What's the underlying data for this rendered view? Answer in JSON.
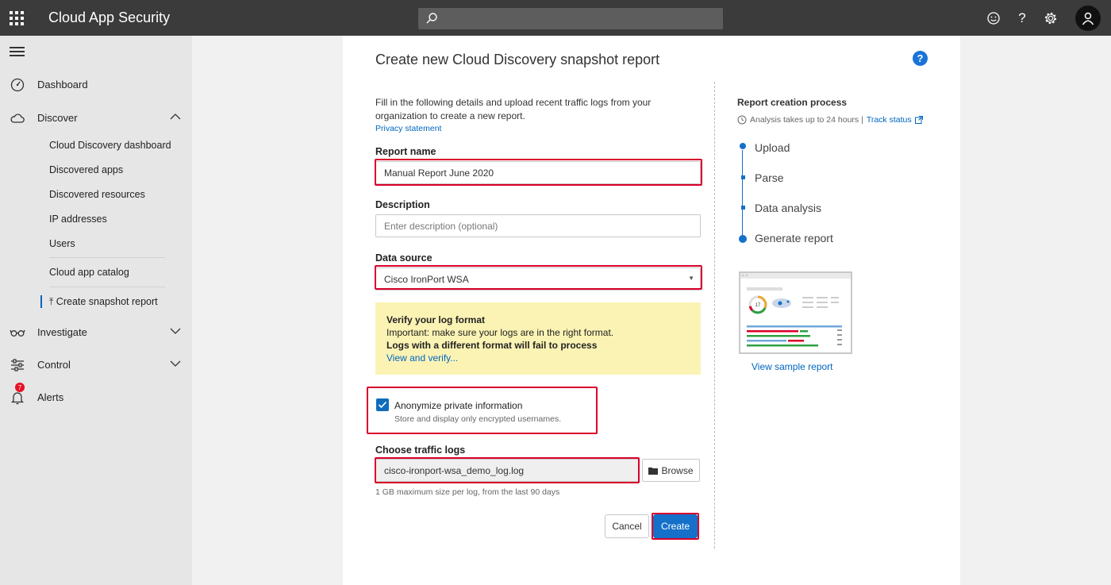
{
  "topbar": {
    "title": "Cloud App Security",
    "search_placeholder": "",
    "icons": [
      "waffle-icon",
      "search-icon",
      "smiley-icon",
      "help-icon",
      "gear-icon",
      "user-icon"
    ]
  },
  "sidebar": {
    "items": [
      {
        "label": "Dashboard",
        "icon": "dashboard-icon"
      },
      {
        "label": "Discover",
        "icon": "cloud-icon",
        "expanded": true
      },
      {
        "label": "Investigate",
        "icon": "glasses-icon"
      },
      {
        "label": "Control",
        "icon": "sliders-icon"
      },
      {
        "label": "Alerts",
        "icon": "bell-icon",
        "badge": "7"
      }
    ],
    "discover_sub": [
      "Cloud Discovery dashboard",
      "Discovered apps",
      "Discovered resources",
      "IP addresses",
      "Users",
      "Cloud app catalog",
      "Create snapshot report"
    ]
  },
  "form": {
    "title": "Create new Cloud Discovery snapshot report",
    "intro": "Fill in the following details and upload recent traffic logs from your organization to create a new report.",
    "privacy_link": "Privacy statement",
    "report_name_label": "Report name",
    "report_name_value": "Manual Report June 2020",
    "description_label": "Description",
    "description_placeholder": "Enter description (optional)",
    "data_source_label": "Data source",
    "data_source_value": "Cisco IronPort WSA",
    "verify": {
      "title": "Verify your log format",
      "line1": "Important: make sure your logs are in the right format.",
      "line2": "Logs with a different format will fail to process",
      "link": "View and verify..."
    },
    "anonymize_label": "Anonymize private information",
    "anonymize_sub": "Store and display only encrypted usernames.",
    "anonymize_checked": true,
    "traffic_logs_label": "Choose traffic logs",
    "traffic_logs_value": "cisco-ironport-wsa_demo_log.log",
    "browse_label": "Browse",
    "hint": "1 GB maximum size per log, from the last 90 days",
    "cancel_label": "Cancel",
    "create_label": "Create"
  },
  "process": {
    "title": "Report creation process",
    "note": "Analysis takes up to 24 hours |",
    "track_link": "Track status",
    "steps": [
      "Upload",
      "Parse",
      "Data analysis",
      "Generate report"
    ],
    "sample_link": "View sample report",
    "thumb_number": "17"
  },
  "colors": {
    "accent": "#1570c9",
    "highlight": "#d9002b",
    "topbar": "#3b3b3b",
    "sidebar": "#e6e6e6",
    "warning_bg": "#fbf3b4"
  }
}
